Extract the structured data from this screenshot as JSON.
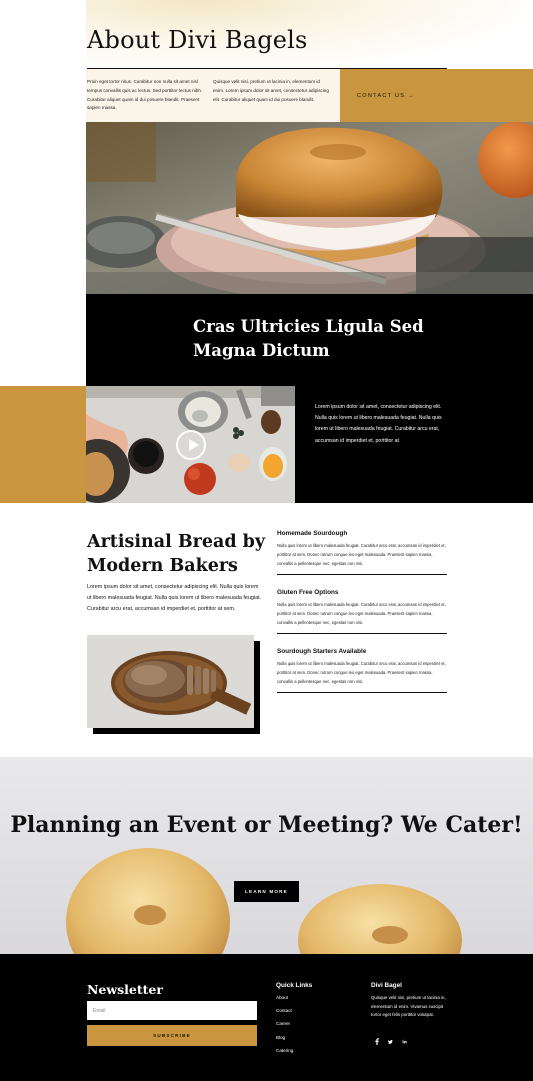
{
  "hero": {
    "title": "About Divi Bagels",
    "intro_col1": "Proin eget tortor risus. Curabitur non nulla sit amet nisl tempus convallis quis ac lectus. Sed porttitor lectus nibh. Curabitur aliquet quam id dui posuere blandit. Praesent sapien massa.",
    "intro_col2": "Quisque velit nisi, pretium ut lacinia in, elementum id enim. Lorem ipsum dolor sit amet, consectetur adipiscing elit. Curabitur aliquet quam id dui posuere blandit.",
    "contact_label": "CONTACT US →"
  },
  "feature": {
    "title": "Cras Ultricies Ligula Sed Magna Dictum",
    "text": "Lorem ipsum dolor sit amet, consectetur adipiscing elit. Nulla quis lorem ut libero malesuada feugiat. Nulla quis lorem ut libero malesuada feugiat. Curabitur arcu erat, accumsan id imperdiet et, porttitor at"
  },
  "artisinal": {
    "title": "Artisinal Bread by Modern Bakers",
    "text": "Lorem ipsum dolor sit amet, consectetur adipiscing elit. Nulla quis lorem ut libero malesuada feugiat. Nulla quis lorem ut libero malesuada feugiat. Curabitur arcu erat, accumsan id imperdiet et, porttitor at sem.",
    "items": [
      {
        "title": "Homemade Sourdough",
        "text": "Nulla quis lorem ut libero malesuada feugiat. Curabitur arcu erat, accumsan id imperdiet et, porttitor at sem. Donec rutrum congue leo eget malesuada. Praesent sapien massa, convallis a pellentesque nec, egestas non nisi."
      },
      {
        "title": "Gluten Free Options",
        "text": "Nulla quis lorem ut libero malesuada feugiat. Curabitur arcu erat, accumsan id imperdiet et, porttitor at sem. Donec rutrum congue leo eget malesuada. Praesent sapien massa, convallis a pellentesque nec, egestas non nisi."
      },
      {
        "title": "Sourdough Starters Available",
        "text": "Nulla quis lorem ut libero malesuada feugiat. Curabitur arcu erat, accumsan id imperdiet et, porttitor at sem. Donec rutrum congue leo eget malesuada. Praesent sapien massa, convallis a pellentesque nec, egestas non nisi."
      }
    ]
  },
  "catering": {
    "title": "Planning an Event or Meeting? We Cater!",
    "button_label": "LEARN MORE"
  },
  "footer": {
    "newsletter_title": "Newsletter",
    "email_placeholder": "Email",
    "subscribe_label": "SUBSCRIBE",
    "quick_links_title": "Quick Links",
    "quick_links": [
      "About",
      "Contact",
      "Career",
      "Blog",
      "Catering"
    ],
    "brand_title": "Divi Bagel",
    "brand_text": "Quisque velit nisi, pretium ut lacinia in, elementum id enim. Vivamus suscipit tortor eget felis porttitor volutpat.",
    "social_icons": [
      "facebook-icon",
      "twitter-icon",
      "linkedin-icon"
    ]
  },
  "colors": {
    "accent_gold": "#c9953f",
    "black": "#000000",
    "cream": "#fbf5e9"
  }
}
